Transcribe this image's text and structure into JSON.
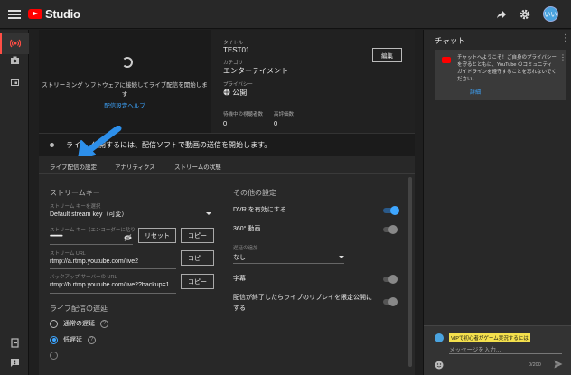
{
  "app": {
    "brand": "Studio",
    "avatar_initials": "いい"
  },
  "preview": {
    "message": "ストリーミング ソフトウェアに接続してライブ配信を開始します",
    "help_link": "配信設定ヘルプ"
  },
  "details": {
    "title_label": "タイトル",
    "title_value": "TEST01",
    "category_label": "カテゴリ",
    "category_value": "エンターテイメント",
    "privacy_label": "プライバシー",
    "privacy_value": "公開",
    "edit_button": "編集",
    "waiting_label": "待機中の視聴者数",
    "waiting_value": "0",
    "likes_label": "高評価数",
    "likes_value": "0"
  },
  "status": {
    "text": "ライブ配信を公開するには、配信ソフトで動画の送信を開始します。",
    "visible_text_start": "ライ",
    "visible_text_end": "公開するには、配信ソフトで動画の送信を開始します。"
  },
  "tabs": [
    {
      "label": "ライブ配信の設定",
      "active": true
    },
    {
      "label": "アナリティクス",
      "active": false
    },
    {
      "label": "ストリームの状態",
      "active": false
    }
  ],
  "stream_key": {
    "section_title": "ストリームキー",
    "select_label": "ストリーム キーを選択",
    "select_value": "Default stream key（可変）",
    "key_label": "ストリーム キー（エンコーダーに貼り",
    "key_value": "••••••••••••••••••••••",
    "reset_button": "リセット",
    "copy_button": "コピー",
    "url_label": "ストリーム URL",
    "url_value": "rtmp://a.rtmp.youtube.com/live2",
    "backup_label": "バックアップ サーバーの URL",
    "backup_value": "rtmp://b.rtmp.youtube.com/live2?backup=1"
  },
  "latency": {
    "section_title": "ライブ配信の遅延",
    "options": [
      {
        "label": "通常の遅延",
        "selected": false
      },
      {
        "label": "低遅延",
        "selected": true
      }
    ]
  },
  "other": {
    "section_title": "その他の設定",
    "dvr_label": "DVR を有効にする",
    "dvr_on": true,
    "vr_label": "360° 動画",
    "vr_on": false,
    "delay_label": "遅延の追加",
    "delay_value": "なし",
    "captions_label": "字幕",
    "captions_on": false,
    "replay_label_1": "配信が終了したらライブのリプレイを限定公開に",
    "replay_label_2": "する",
    "replay_on": false
  },
  "chat": {
    "title": "チャット",
    "notice": "チャットへようこそ！ご自身のプライバシーを守るとともに、YouTube のコミュニティ ガイドラインを遵守することを忘れないでください。",
    "notice_link": "詳細",
    "user_name": "VIPで初心者がゲーム実況するには",
    "input_placeholder": "メッセージを入力...",
    "char_count": "0/200"
  },
  "colors": {
    "accent": "#3ea6ff",
    "brand": "#ff0000",
    "background": "#1f1f1f"
  }
}
